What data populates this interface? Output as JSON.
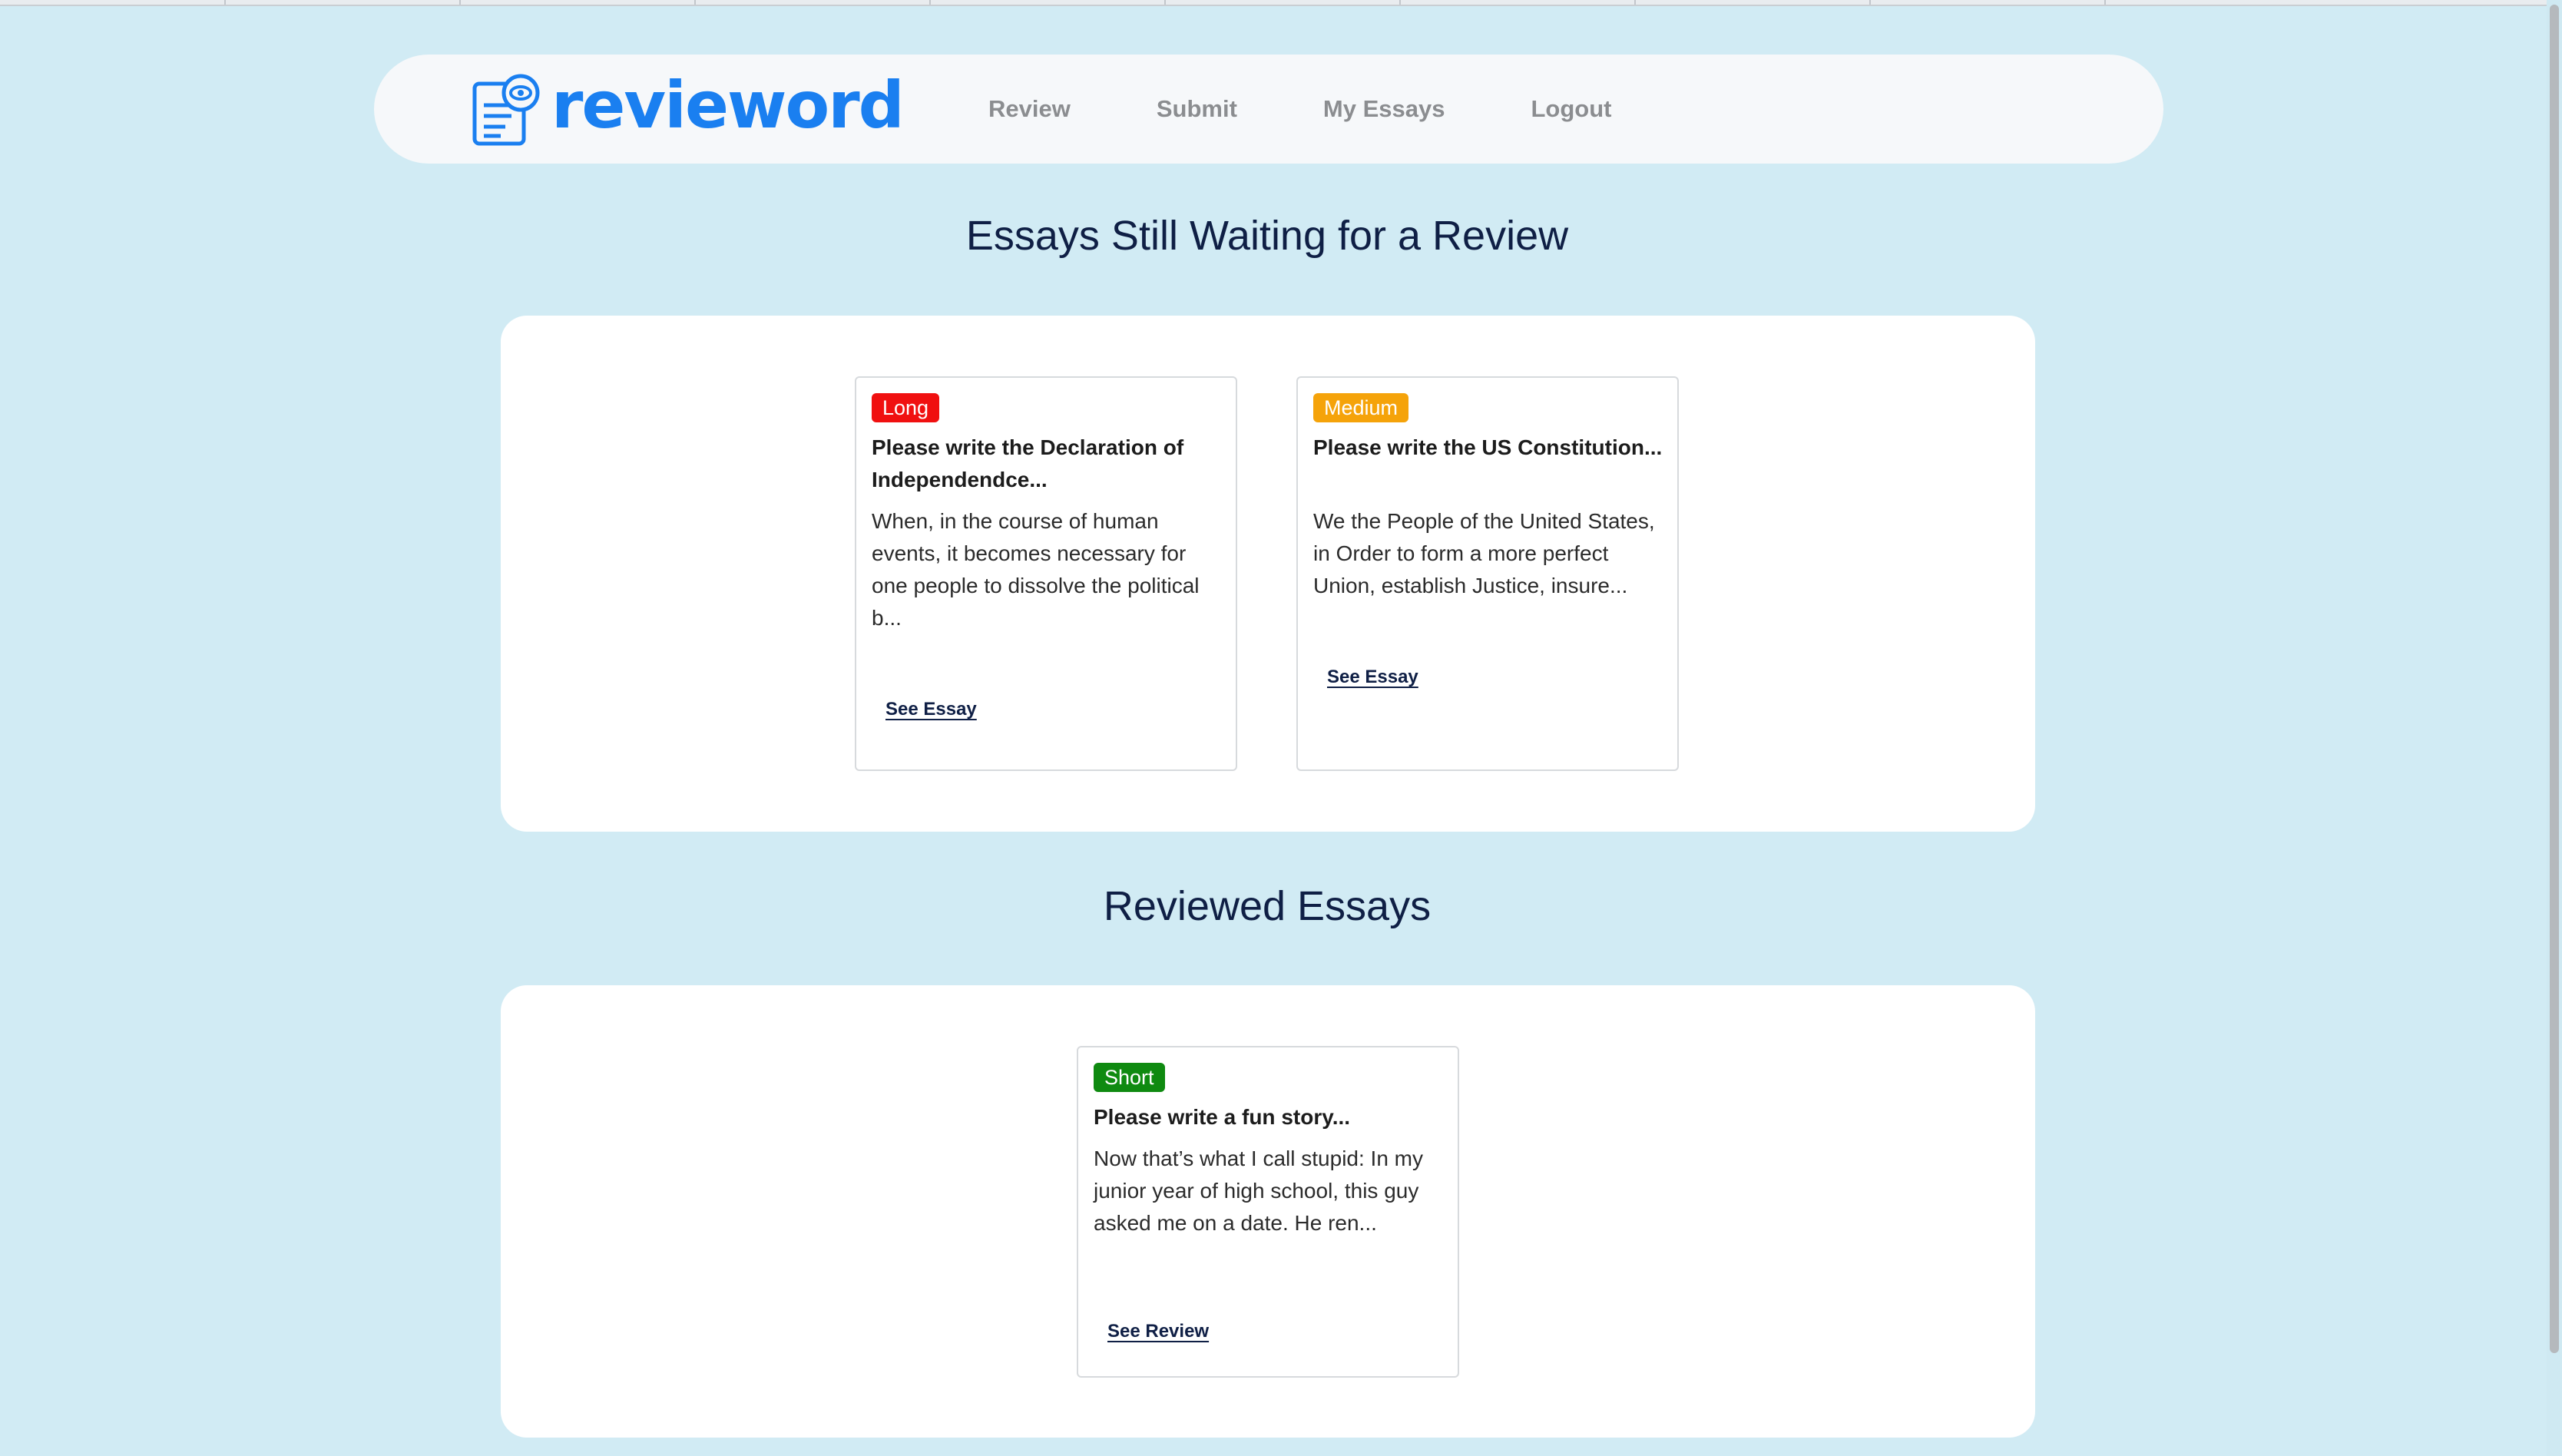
{
  "nav": {
    "brand": "revieword",
    "links": [
      "Review",
      "Submit",
      "My Essays",
      "Logout"
    ]
  },
  "waiting": {
    "heading": "Essays Still Waiting for a Review",
    "cards": [
      {
        "badge": "Long",
        "title": "Please write the Declaration of Independendce...",
        "body": "When, in the course of human events, it becomes necessary for one people to dissolve the political b...",
        "link": "See Essay"
      },
      {
        "badge": "Medium",
        "title": "Please write the US Constitution...",
        "body": "We the People of the United States, in Order to form a more perfect Union, establish Justice, insure...",
        "link": "See Essay"
      }
    ]
  },
  "reviewed": {
    "heading": "Reviewed Essays",
    "cards": [
      {
        "badge": "Short",
        "title": "Please write a fun story...",
        "body": "Now that’s what I call stupid: In my junior year of high school, this guy asked me on a date. He ren...",
        "link": "See Review"
      }
    ]
  },
  "colors": {
    "background": "#d1ebf4",
    "brand": "#1a7ff0",
    "heading": "#0f1f45",
    "badge_long": "#f01010",
    "badge_medium": "#f5a30a",
    "badge_short": "#0f8a10"
  },
  "icons": {
    "logo": "document-eye-icon"
  }
}
